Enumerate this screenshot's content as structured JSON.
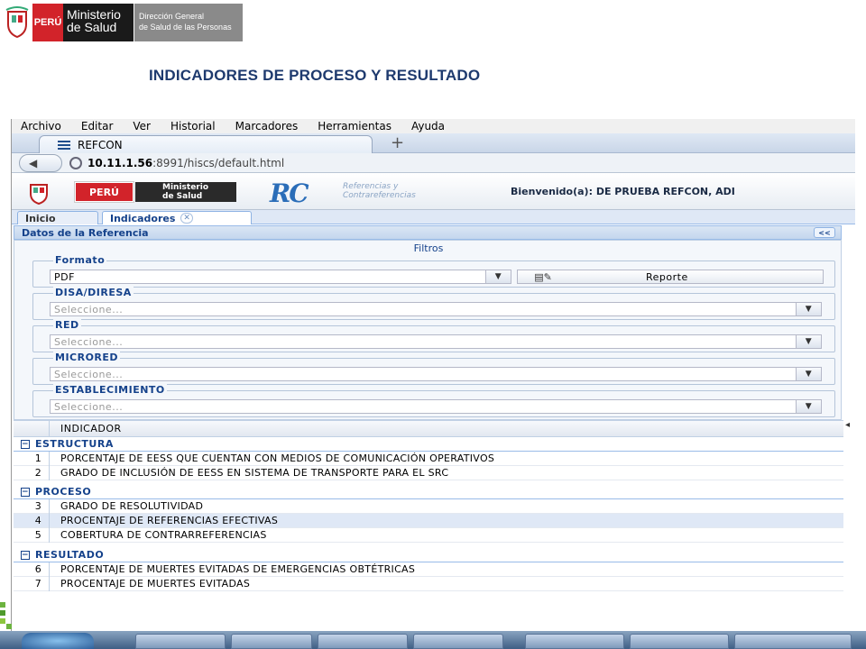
{
  "slide": {
    "logo": {
      "peru": "PERÚ",
      "ministry_line1": "Ministerio",
      "ministry_line2": "de Salud",
      "directorate_line1": "Dirección General",
      "directorate_line2": "de Salud de las Personas"
    },
    "title": "INDICADORES DE PROCESO Y RESULTADO"
  },
  "browser": {
    "menu": [
      "Archivo",
      "Editar",
      "Ver",
      "Historial",
      "Marcadores",
      "Herramientas",
      "Ayuda"
    ],
    "tab_title": "REFCON",
    "new_tab": "+",
    "url_host": "10.11.1.56",
    "url_rest": ":8991/hiscs/default.html"
  },
  "app": {
    "header": {
      "peru": "PERÚ",
      "ministry_line1": "Ministerio",
      "ministry_line2": "de Salud",
      "rc_logo": "RC",
      "rc_sub_line1": "Referencias y",
      "rc_sub_line2": "Contrareferencias",
      "welcome": "Bienvenido(a): DE PRUEBA REFCON, ADI"
    },
    "tabs": [
      {
        "label": "Inicio"
      },
      {
        "label": "Indicadores",
        "close": "✕"
      }
    ],
    "panel_title": "Datos de la Referencia",
    "collapse_label": "<<",
    "filters_title": "Filtros",
    "filters": {
      "formato": {
        "legend": "Formato",
        "value": "PDF",
        "report_label": "Reporte"
      },
      "disa": {
        "legend": "DISA/DIRESA",
        "placeholder": "Seleccione..."
      },
      "red": {
        "legend": "RED",
        "placeholder": "Seleccione..."
      },
      "microred": {
        "legend": "MICRORED",
        "placeholder": "Seleccione..."
      },
      "establecimiento": {
        "legend": "ESTABLECIMIENTO",
        "placeholder": "Seleccione..."
      }
    },
    "grid": {
      "header": "INDICADOR",
      "groups": [
        {
          "name": "ESTRUCTURA",
          "rows": [
            {
              "n": "1",
              "text": "PORCENTAJE DE EESS QUE CUENTAN CON MEDIOS DE COMUNICACIÓN OPERATIVOS"
            },
            {
              "n": "2",
              "text": "GRADO DE INCLUSIÓN DE EESS EN SISTEMA DE TRANSPORTE PARA EL SRC"
            }
          ]
        },
        {
          "name": "PROCESO",
          "rows": [
            {
              "n": "3",
              "text": "GRADO DE RESOLUTIVIDAD"
            },
            {
              "n": "4",
              "text": "PROCENTAJE DE REFERENCIAS EFECTIVAS"
            },
            {
              "n": "5",
              "text": "COBERTURA DE CONTRARREFERENCIAS"
            }
          ]
        },
        {
          "name": "RESULTADO",
          "rows": [
            {
              "n": "6",
              "text": "PORCENTAJE DE MUERTES EVITADAS DE EMERGENCIAS OBTÉTRICAS"
            },
            {
              "n": "7",
              "text": "PROCENTAJE DE MUERTES EVITADAS"
            }
          ]
        }
      ]
    }
  },
  "colors": {
    "title_blue": "#1e3a6e",
    "peru_red": "#d2232a",
    "ext_blue": "#15428b"
  }
}
